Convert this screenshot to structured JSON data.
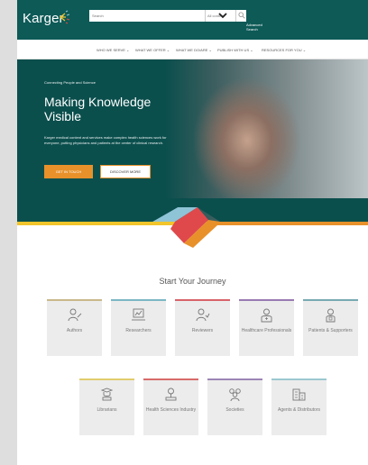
{
  "header": {
    "logo": "Karger",
    "search_placeholder": "Search",
    "search_scope": "All content",
    "advanced_search": "Advanced Search"
  },
  "nav": {
    "items": [
      {
        "label": "WHO WE SERVE ⌄"
      },
      {
        "label": "WHAT WE OFFER ⌄"
      },
      {
        "label": "WHAT WE DO/ARE ⌄"
      },
      {
        "label": "PUBLISH WITH US ⌄"
      },
      {
        "label": "RESOURCES FOR YOU ⌄"
      }
    ]
  },
  "hero": {
    "eyebrow": "Connecting People and Science",
    "title": "Making Knowledge Visible",
    "description": "Karger medical content and services make complex health sciences work for everyone, putting physicians and patients at the center of clinical research.",
    "cta_primary": "GET IN TOUCH",
    "cta_secondary": "DISCOVER MORE"
  },
  "journey": {
    "title": "Start Your Journey",
    "cards": [
      {
        "label": "Authors",
        "icon": "author-icon",
        "color": "#c9b88a"
      },
      {
        "label": "Researchers",
        "icon": "researcher-icon",
        "color": "#7bb7c4"
      },
      {
        "label": "Reviewers",
        "icon": "reviewer-icon",
        "color": "#d8636a"
      },
      {
        "label": "Healthcare Professionals",
        "icon": "healthcare-icon",
        "color": "#9a7ab2"
      },
      {
        "label": "Patients & Supporters",
        "icon": "patient-icon",
        "color": "#78aab3"
      },
      {
        "label": "Librarians",
        "icon": "librarian-icon",
        "color": "#e2cc6e"
      },
      {
        "label": "Health Sciences Industry",
        "icon": "industry-icon",
        "color": "#d86a6a"
      },
      {
        "label": "Societies",
        "icon": "societies-icon",
        "color": "#9b86b6"
      },
      {
        "label": "Agents & Distributors",
        "icon": "agents-icon",
        "color": "#9cc8d0"
      }
    ]
  },
  "colors": {
    "brand_teal": "#0d5a57",
    "accent_orange": "#e8912a",
    "stripe_yellow": "#f1c52b",
    "stripe_red": "#e0494b",
    "stripe_blue": "#8fc3d6"
  }
}
